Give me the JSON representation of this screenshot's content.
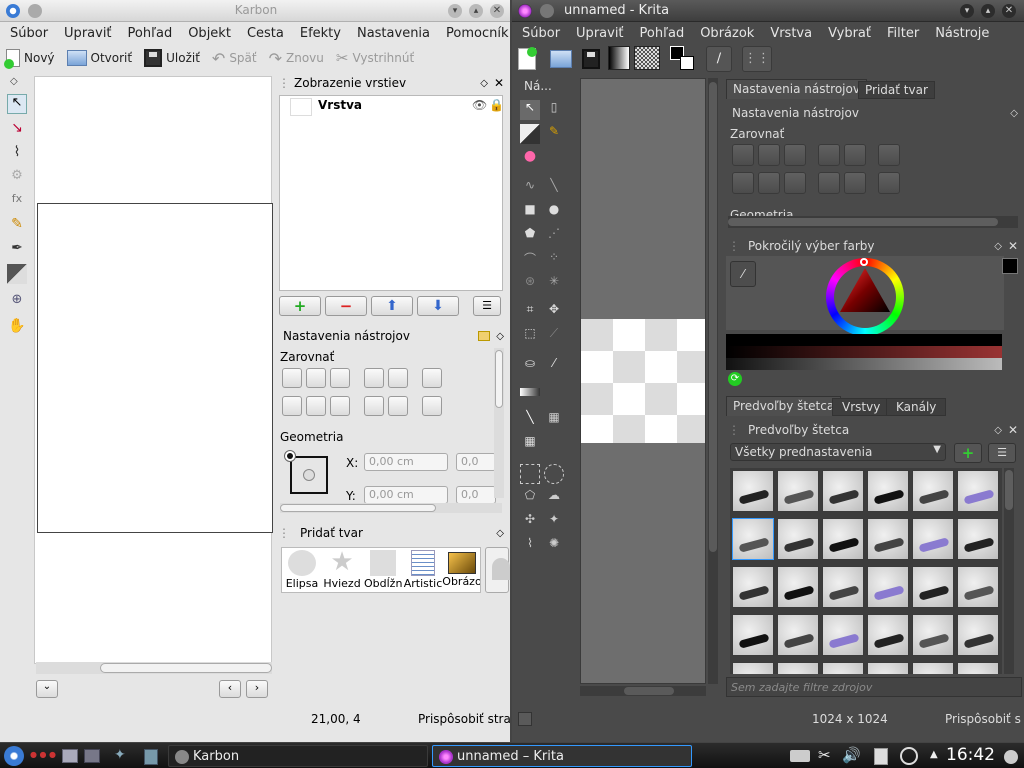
{
  "karbon": {
    "title": "Karbon",
    "menu": [
      "Súbor",
      "Upraviť",
      "Pohľad",
      "Objekt",
      "Cesta",
      "Efekty",
      "Nastavenia",
      "Pomocník"
    ],
    "toolbar": {
      "new": "Nový",
      "open": "Otvoriť",
      "save": "Uložiť",
      "undo": "Späť",
      "redo": "Znovu",
      "cut": "Vystrihnúť"
    },
    "layers": {
      "title": "Zobrazenie vrstiev",
      "layer_name": "Vrstva"
    },
    "tool_options": {
      "title": "Nastavenia nástrojov",
      "align": "Zarovnať",
      "geometry": "Geometria",
      "x_label": "X:",
      "y_label": "Y:",
      "x_value": "0,00 cm",
      "y_value": "0,00 cm",
      "x2_value": "0,0",
      "y2_value": "0,0"
    },
    "add_shape": {
      "title": "Pridať tvar",
      "shapes": [
        "Elipsa",
        "Hviezd",
        "Obdĺžn",
        "Artistic",
        "Obrázo"
      ]
    },
    "status": {
      "coords": "21,00, 4",
      "fit": "Prispôsobiť stra"
    }
  },
  "krita": {
    "title": "unnamed - Krita",
    "menu": [
      "Súbor",
      "Upraviť",
      "Pohľad",
      "Obrázok",
      "Vrstva",
      "Vybrať",
      "Filter",
      "Nástroje"
    ],
    "toolbox_title": "Ná...",
    "tabs_top": [
      "Nastavenia nástrojov",
      "Pridať tvar"
    ],
    "tool_options": {
      "title": "Nastavenia nástrojov",
      "align": "Zarovnať",
      "geometry": "Geometria"
    },
    "color": {
      "title": "Pokročilý výber farby",
      "selected": "#000000"
    },
    "tabs_mid": [
      "Predvoľby štetca",
      "Vrstvy",
      "Kanály"
    ],
    "presets": {
      "title": "Predvoľby štetca",
      "filter": "Všetky prednastavenia",
      "search_placeholder": "Sem zadajte filtre zdrojov"
    },
    "status": {
      "size": "1024 x 1024",
      "fit": "Prispôsobiť s"
    }
  },
  "taskbar": {
    "tasks": [
      {
        "label": "Karbon"
      },
      {
        "label": "unnamed – Krita"
      }
    ],
    "clock": "16:42"
  }
}
